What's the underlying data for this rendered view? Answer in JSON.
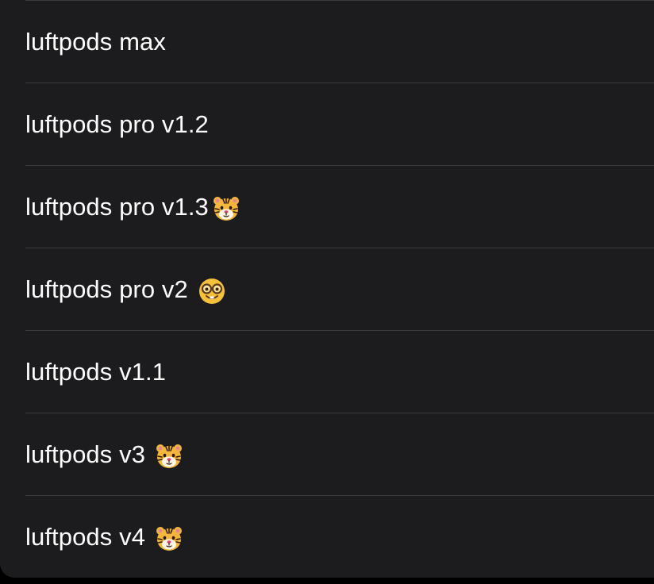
{
  "list": {
    "items": [
      {
        "label": "luftpods max",
        "icon": null
      },
      {
        "label": "luftpods pro v1.2",
        "icon": null
      },
      {
        "label": "luftpods pro v1.3",
        "icon": "tiger-face-icon"
      },
      {
        "label": "luftpods pro v2",
        "icon": "nerd-face-icon"
      },
      {
        "label": "luftpods v1.1",
        "icon": null
      },
      {
        "label": "luftpods v3",
        "icon": "tiger-face-icon"
      },
      {
        "label": "luftpods v4",
        "icon": "tiger-face-icon"
      }
    ]
  },
  "colors": {
    "background": "#1c1c1e",
    "separator": "#3a3a3c",
    "text": "#ffffff"
  }
}
